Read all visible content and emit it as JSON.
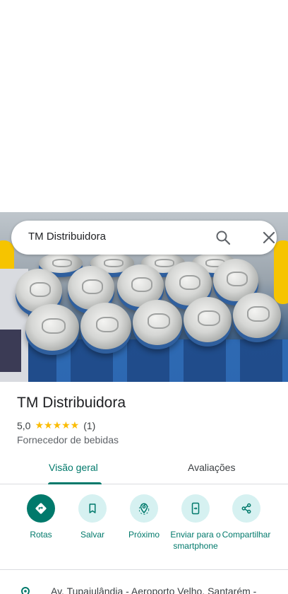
{
  "search": {
    "query": "TM Distribuidora"
  },
  "place": {
    "name": "TM Distribuidora",
    "rating": "5,0",
    "stars": "★★★★★",
    "review_count": "(1)",
    "category": "Fornecedor de bebidas"
  },
  "tabs": [
    {
      "label": "Visão geral",
      "active": true
    },
    {
      "label": "Avaliações",
      "active": false
    }
  ],
  "actions": [
    {
      "label": "Rotas",
      "icon": "directions-icon"
    },
    {
      "label": "Salvar",
      "icon": "bookmark-icon"
    },
    {
      "label": "Próximo",
      "icon": "nearby-icon"
    },
    {
      "label": "Enviar para o smartphone",
      "icon": "send-to-phone-icon"
    },
    {
      "label": "Compartilhar",
      "icon": "share-icon"
    }
  ],
  "address": {
    "text": "Av. Tupaiulândia - Aeroporto Velho, Santarém -"
  },
  "colors": {
    "accent": "#00796b",
    "accent_light": "#d6f1f1",
    "star": "#fbbc04"
  }
}
